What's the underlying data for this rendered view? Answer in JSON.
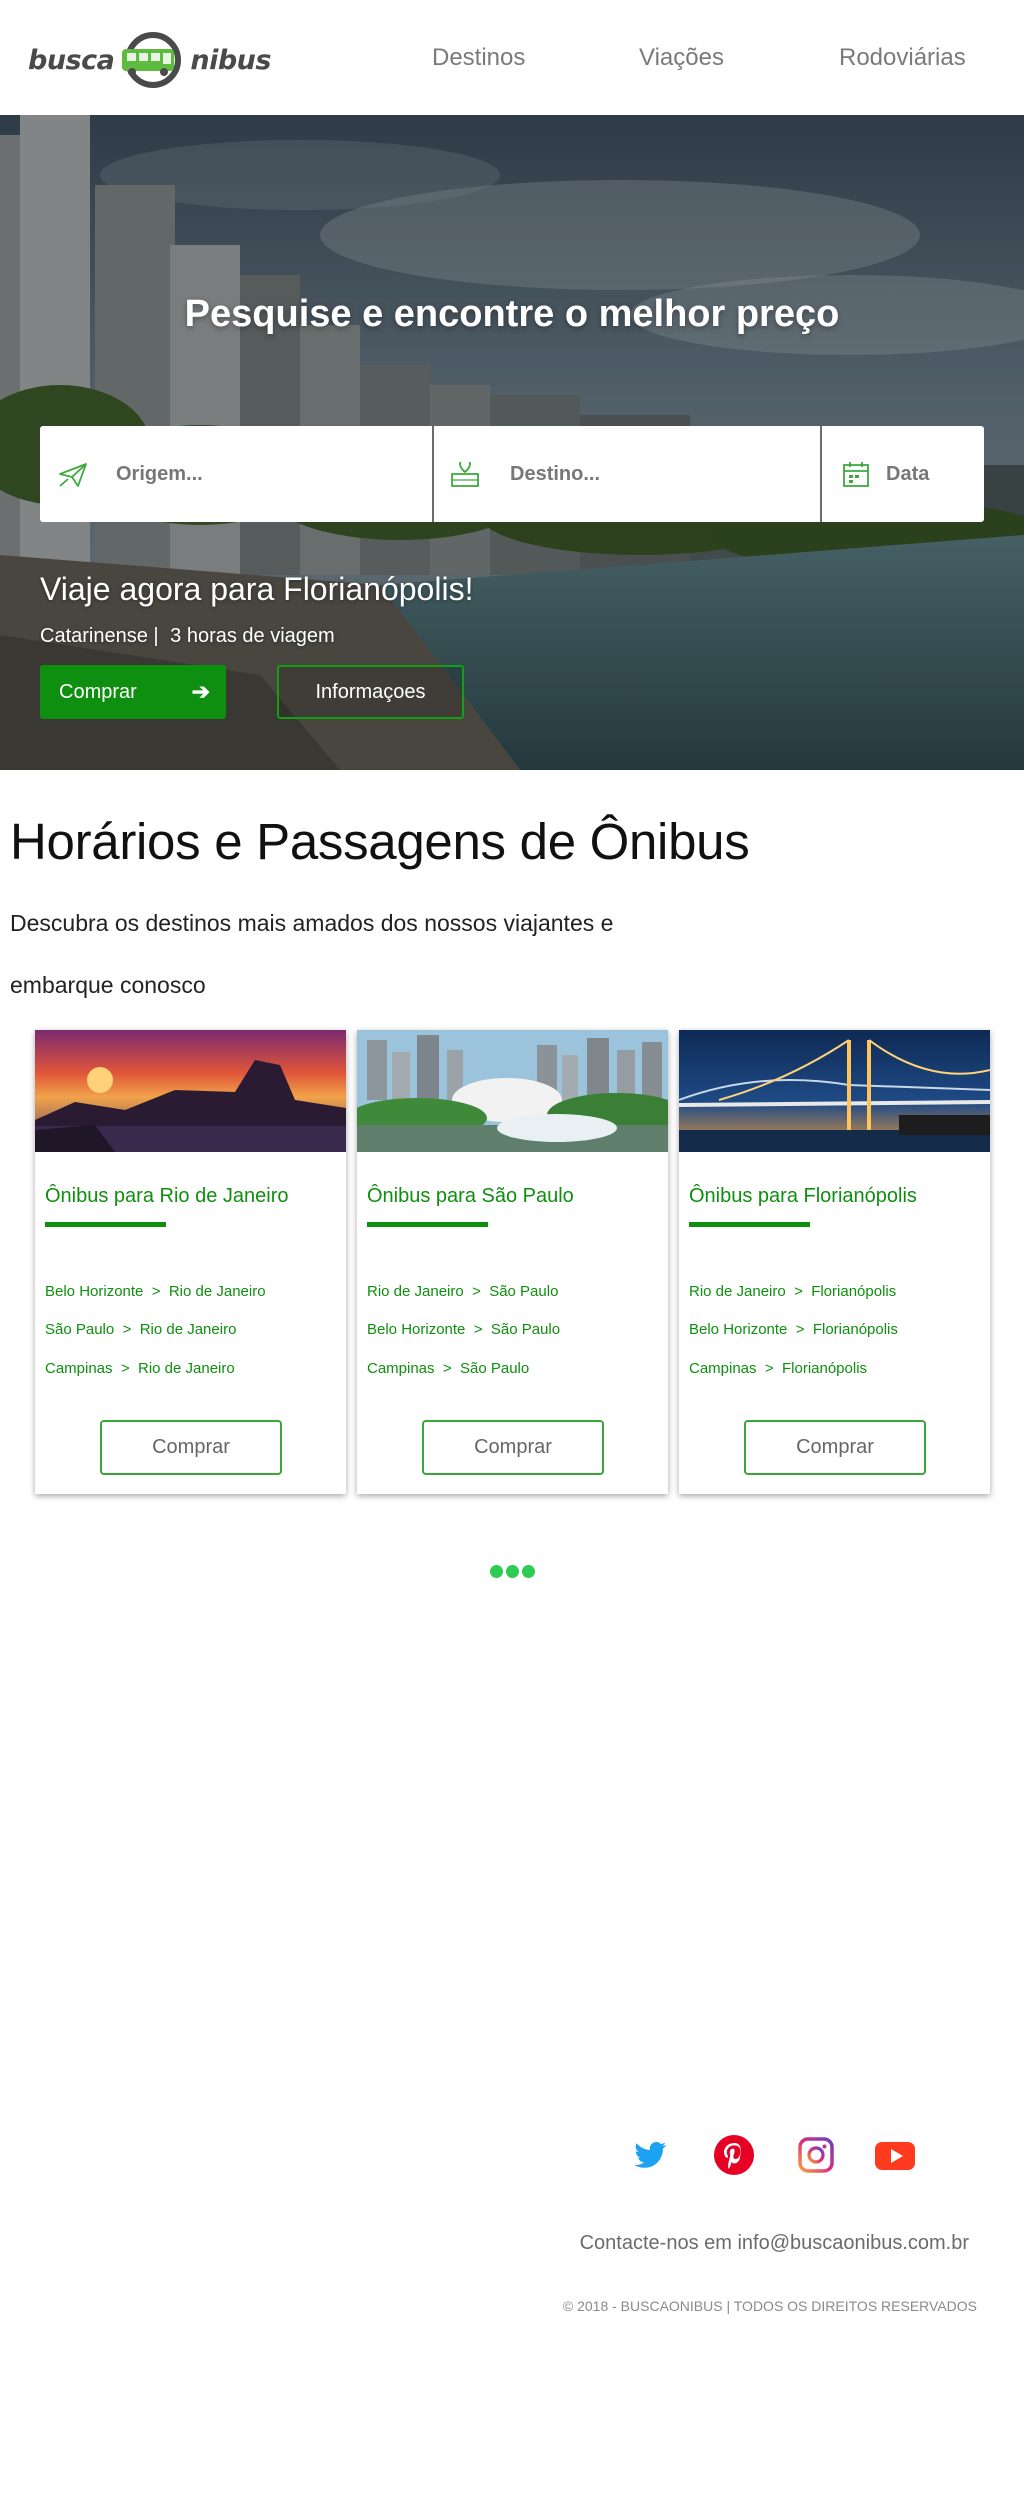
{
  "header": {
    "logo": {
      "left_word": "busca",
      "right_word": "nibus"
    },
    "nav": [
      "Destinos",
      "Viações",
      "Rodoviárias"
    ]
  },
  "hero": {
    "title": "Pesquise e encontre o melhor preço",
    "search": {
      "origin_placeholder": "Origem...",
      "destination_placeholder": "Destino...",
      "date_placeholder": "Data"
    },
    "promo": {
      "title": "Viaje agora para Florianópolis!",
      "company": "Catarinense |",
      "duration": "3 horas de viagem",
      "buy_label": "Comprar",
      "buy_icon": "arrow-right-icon",
      "info_label": "Informaçoes"
    }
  },
  "section": {
    "title": "Horários e Passagens de Ônibus",
    "description_line1": "Descubra os destinos mais amados dos nossos viajantes e",
    "description_line2": "embarque conosco"
  },
  "cards": [
    {
      "title": "Ônibus para Rio de Janeiro",
      "routes": [
        {
          "from": "Belo Horizonte",
          "to": "Rio de Janeiro"
        },
        {
          "from": "São Paulo",
          "to": "Rio de Janeiro"
        },
        {
          "from": "Campinas",
          "to": "Rio de Janeiro"
        }
      ],
      "button": "Comprar"
    },
    {
      "title": "Ônibus para São Paulo",
      "routes": [
        {
          "from": "Rio de Janeiro",
          "to": "São Paulo"
        },
        {
          "from": "Belo Horizonte",
          "to": "São Paulo"
        },
        {
          "from": "Campinas",
          "to": "São Paulo"
        }
      ],
      "button": "Comprar"
    },
    {
      "title": "Ônibus para Florianópolis",
      "routes": [
        {
          "from": "Rio de Janeiro",
          "to": "Florianópolis"
        },
        {
          "from": "Belo Horizonte",
          "to": "Florianópolis"
        },
        {
          "from": "Campinas",
          "to": "Florianópolis"
        }
      ],
      "button": "Comprar"
    }
  ],
  "route_separator": ">",
  "footer": {
    "social": [
      "twitter-icon",
      "pinterest-icon",
      "instagram-icon",
      "youtube-icon"
    ],
    "contact": "Contacte-nos em info@buscaonibus.com.br",
    "copyright": "© 2018 - BUSCAONIBUS | TODOS OS DIREITOS RESERVADOS"
  },
  "colors": {
    "brand_green": "#0f8f0f",
    "accent_green": "#2ecc52",
    "logo_green": "#5dbb3f",
    "text_gray": "#7a7a7a"
  }
}
